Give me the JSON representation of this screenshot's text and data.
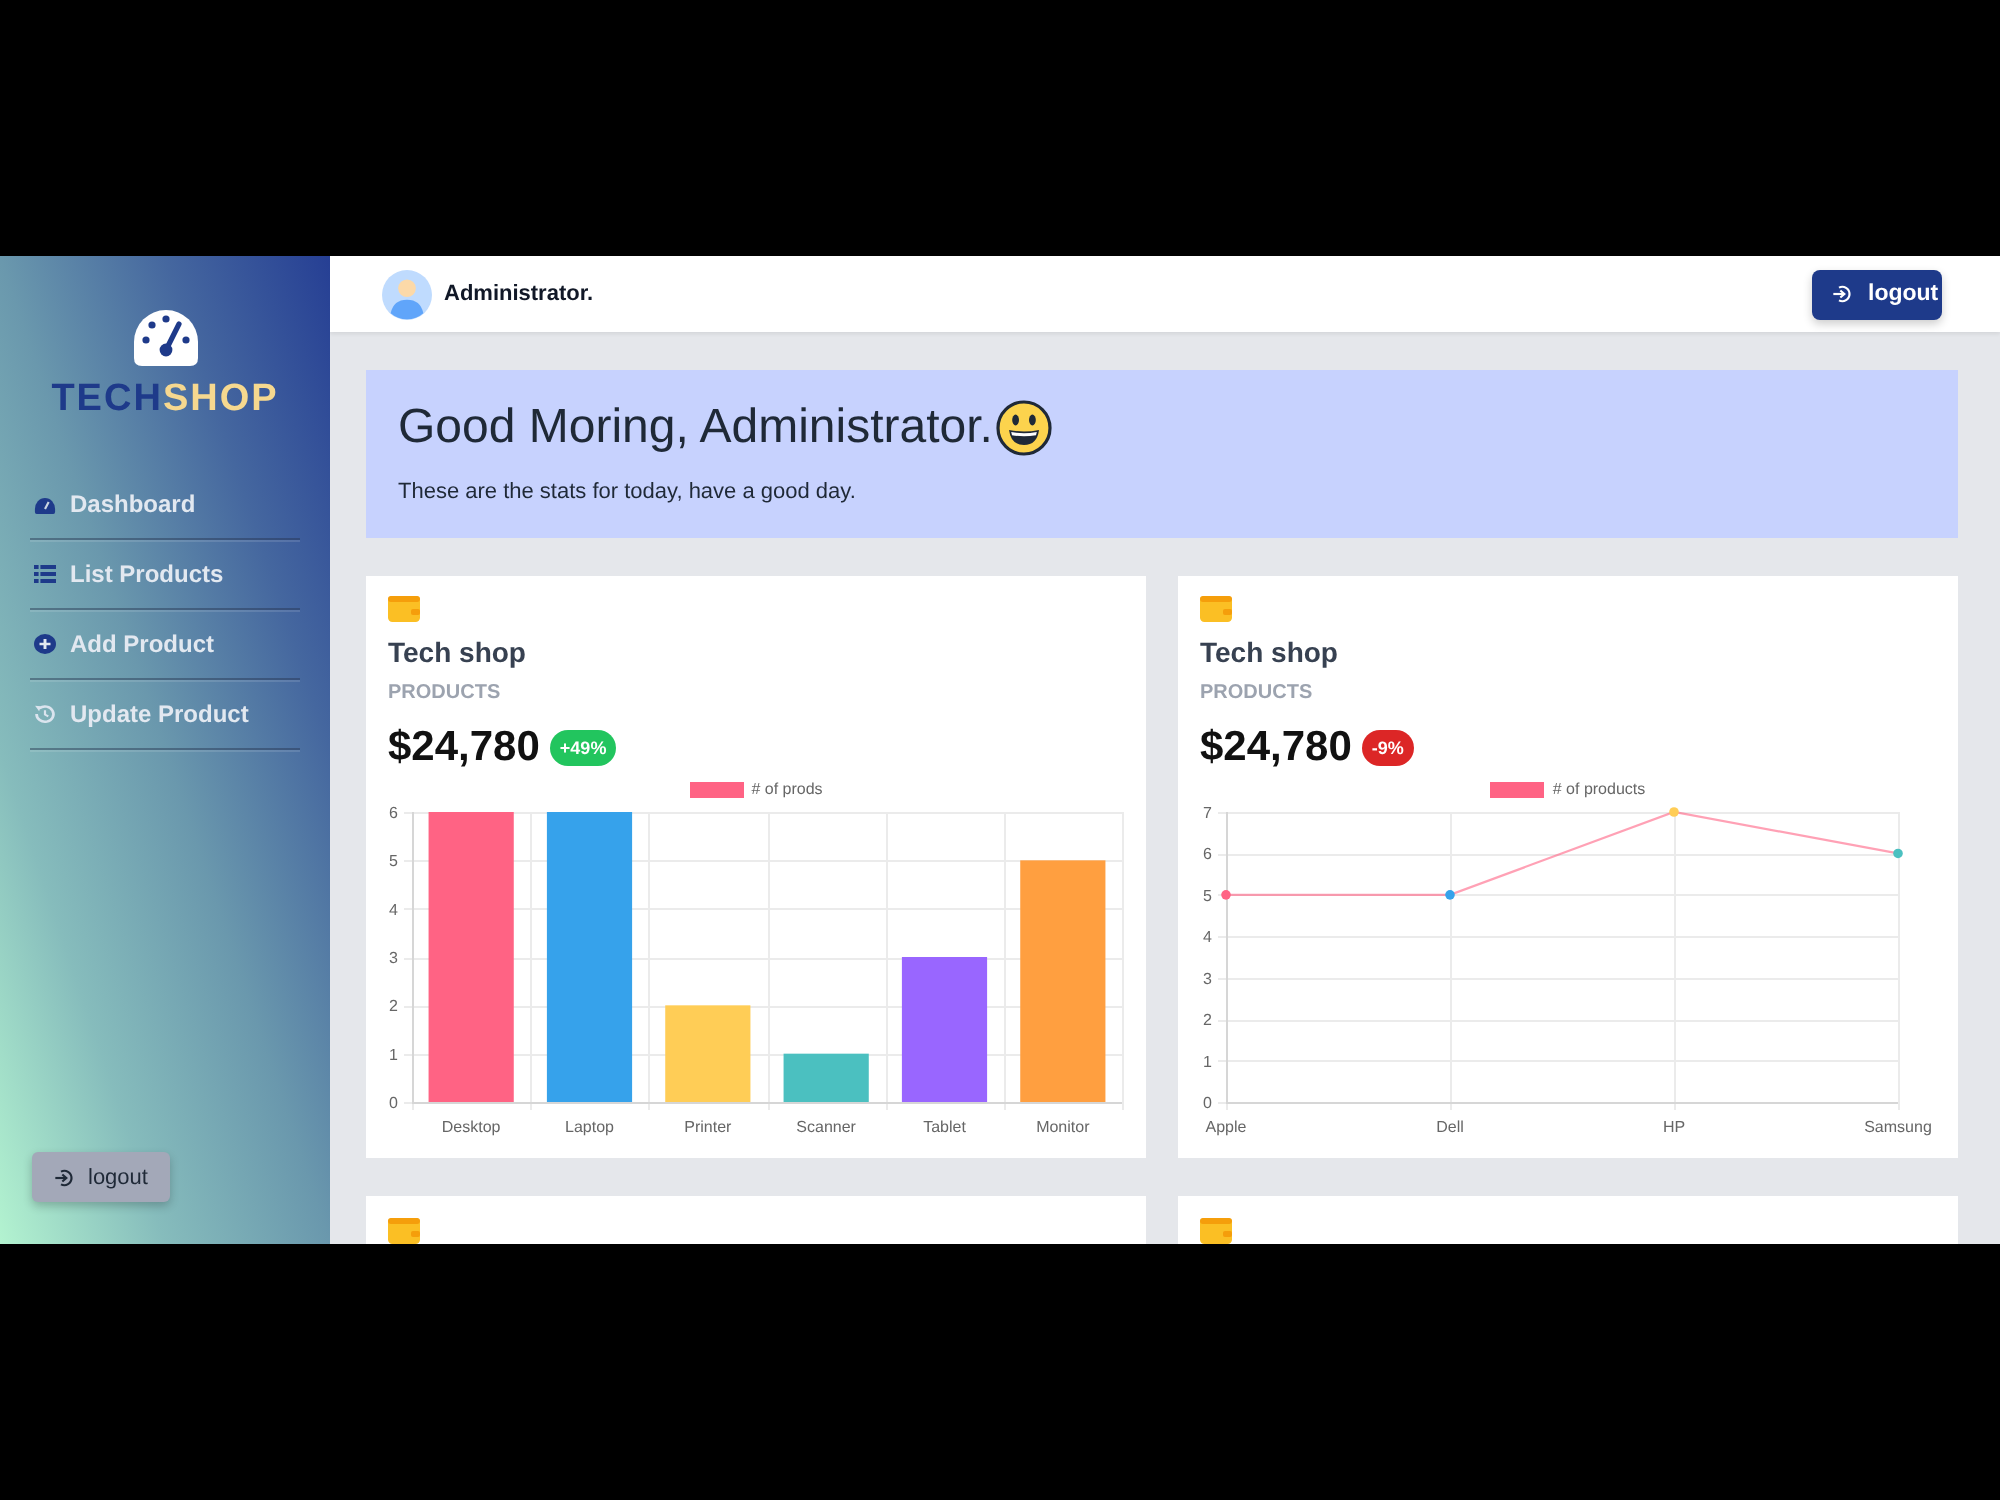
{
  "sidebar": {
    "logo_parts": [
      "TECH",
      "SHOP"
    ],
    "nav_items": [
      {
        "label": "Dashboard"
      },
      {
        "label": "List Products"
      },
      {
        "label": "Add Product"
      },
      {
        "label": "Update Product"
      }
    ],
    "logout_button": "logout"
  },
  "header": {
    "user_name": "Administrator.",
    "logout_button": "logout"
  },
  "banner": {
    "greeting": "Good Moring, Administrator.",
    "subtitle": "These are the stats for today, have a good day."
  },
  "cards": [
    {
      "kind": "stat",
      "title": "Tech shop",
      "label": "PRODUCTS",
      "amount": "$24,780",
      "badge": {
        "text": "+49%",
        "color": "#22c55e"
      },
      "chart_data": {
        "type": "bar",
        "categories": [
          "Desktop",
          "Laptop",
          "Printer",
          "Scanner",
          "Tablet",
          "Monitor"
        ],
        "series": [
          {
            "name": "# of prods",
            "color": "#ff6384",
            "colors": [
              "#ff6384",
              "#36a2eb",
              "#ffcd56",
              "#4bc0c0",
              "#9966ff",
              "#ff9f40"
            ],
            "values": [
              6,
              6,
              2,
              1,
              3,
              5
            ]
          }
        ],
        "ylim": [
          0,
          6
        ],
        "yticks": [
          0,
          1,
          2,
          3,
          4,
          5,
          6
        ],
        "legend": "top",
        "grid": true
      }
    },
    {
      "kind": "stat",
      "title": "Tech shop",
      "label": "PRODUCTS",
      "amount": "$24,780",
      "badge": {
        "text": "-9%",
        "color": "#dc2626"
      },
      "chart_data": {
        "type": "line",
        "categories": [
          "Apple",
          "Dell",
          "HP",
          "Samsung"
        ],
        "series": [
          {
            "name": "# of products",
            "color": "#ff6384",
            "colors": [
              "#ff6384",
              "#36a2eb",
              "#ffcd56",
              "#4bc0c0"
            ],
            "values": [
              5,
              5,
              7,
              6
            ]
          }
        ],
        "ylim": [
          0,
          7
        ],
        "yticks": [
          0,
          1,
          2,
          3,
          4,
          5,
          6,
          7
        ],
        "legend": "top",
        "grid": true,
        "marker": "circle"
      }
    },
    {
      "kind": "cut"
    },
    {
      "kind": "cut"
    }
  ]
}
